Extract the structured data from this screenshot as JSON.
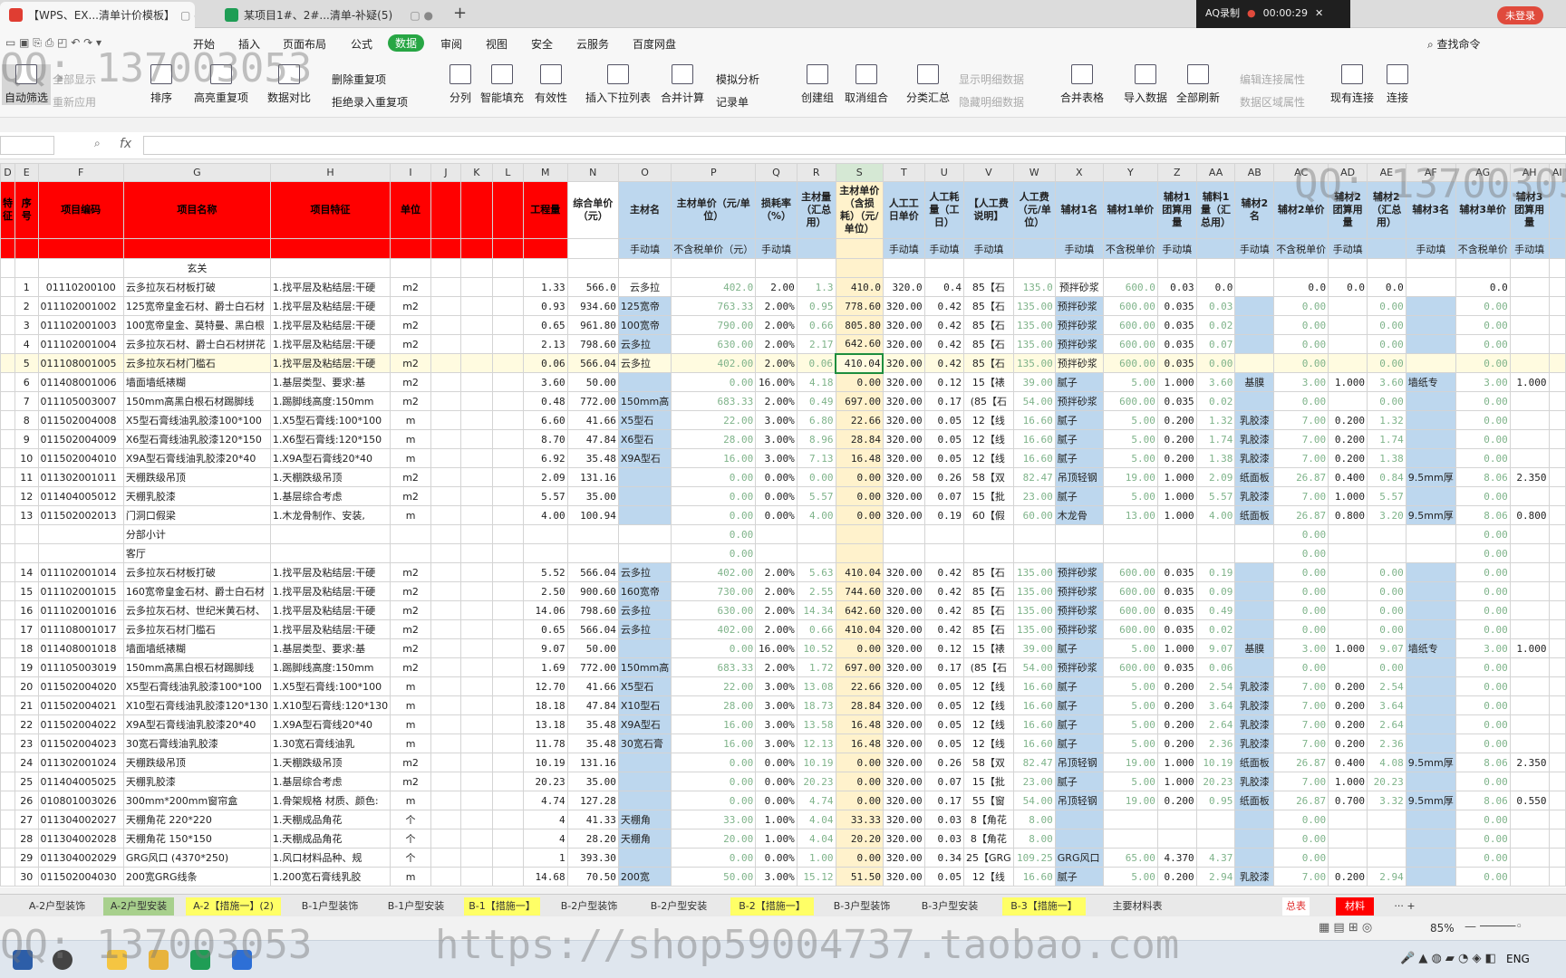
{
  "tabs": [
    {
      "label": "【WPS、EX...清单计价模板】",
      "active": true
    },
    {
      "label": "某项目1#、2#...清单-补疑(5)",
      "active": false
    }
  ],
  "recorder": {
    "name": "AQ录制",
    "time": "00:00:29"
  },
  "login_label": "未登录",
  "menu": [
    "开始",
    "插入",
    "页面布局",
    "公式",
    "数据",
    "审阅",
    "视图",
    "安全",
    "云服务",
    "百度网盘"
  ],
  "find_label": "查找命令",
  "ribbon": {
    "filter": "自动筛选",
    "show_all": "全部显示",
    "reapply": "重新应用",
    "sort": "排序",
    "highlight_dup": "高亮重复项",
    "data_compare": "数据对比",
    "delete_dup": "删除重复项",
    "reject_dup": "拒绝录入重复项",
    "split": "分列",
    "smart_fill": "智能填充",
    "validity": "有效性",
    "dropdown_list": "插入下拉列表",
    "merge_calc": "合并计算",
    "simulate": "模拟分析",
    "record": "记录单",
    "create_group": "创建组",
    "ungroup": "取消组合",
    "subtotal": "分类汇总",
    "show_detail": "显示明细数据",
    "hide_detail": "隐藏明细数据",
    "merge_sheets": "合并表格",
    "import_data": "导入数据",
    "refresh_all": "全部刷新",
    "edit_link": "编辑连接属性",
    "data_range": "数据区域属性",
    "existing_conn": "现有连接",
    "connect": "连接"
  },
  "formula_bar": {
    "fx": "fx"
  },
  "columns": [
    "D",
    "E",
    "F",
    "G",
    "H",
    "I",
    "J",
    "K",
    "L",
    "M",
    "N",
    "O",
    "P",
    "Q",
    "R",
    "S",
    "T",
    "U",
    "V",
    "W",
    "X",
    "Y",
    "Z",
    "AA",
    "AB",
    "AC",
    "AD",
    "AE",
    "AF",
    "AG",
    "AH",
    "AI"
  ],
  "headers": [
    "特征",
    "序号",
    "项目编码",
    "项目名称",
    "项目特征",
    "单位",
    "",
    "",
    "",
    "工程量",
    "综合单价（元）",
    "主材名",
    "主材单价（元/单位）",
    "损耗率（%）",
    "主材量（汇总用）",
    "主材单价（含损耗）（元/单位）",
    "人工工日单价",
    "人工耗量（工日）",
    "【人工费说明】",
    "人工费（元/单位）",
    "辅材1名",
    "辅材1单价",
    "辅材1团算用量",
    "辅料1量（汇总用）",
    "辅材2名",
    "辅材2单价",
    "辅材2团算用量",
    "辅材2（汇总用）",
    "辅材3名",
    "辅材3单价",
    "辅材3团算用量",
    ""
  ],
  "subheaders": [
    "",
    "",
    "",
    "",
    "",
    "",
    "",
    "",
    "",
    "",
    "",
    "手动填",
    "不含税单价（元）",
    "手动填",
    "",
    "",
    "手动填",
    "手动填",
    "手动填",
    "",
    "手动填",
    "不含税单价",
    "手动填",
    "",
    "手动填",
    "不含税单价",
    "手动填",
    "",
    "手动填",
    "不含税单价",
    "手动填",
    ""
  ],
  "section_row": {
    "g": "玄关"
  },
  "filter_row": {
    "e": "1",
    "f": "01110200100",
    "g": "云多拉灰石材板打破",
    "h": "1.找平层及粘结层:干硬",
    "i": "m2",
    "m": "1.33",
    "n": "566.0",
    "o": "云多拉",
    "p": "402.0",
    "q": "2.00",
    "r": "1.3",
    "s": "410.0",
    "t": "320.0",
    "u": "0.4",
    "v": "85【石",
    "w": "135.0",
    "x": "预拌砂浆",
    "y": "600.0",
    "z": "0.03",
    "aa": "0.0",
    "ac": "0.0",
    "ad": "0.0",
    "ae": "0.0",
    "ag": "0.0"
  },
  "rows": [
    {
      "e": "2",
      "f": "011102001002",
      "g": "125宽帝皇金石材、爵士白石材",
      "h": "1.找平层及粘结层:干硬",
      "i": "m2",
      "m": "0.93",
      "n": "934.60",
      "o": "125宽帝",
      "p": "763.33",
      "q": "2.00%",
      "r": "0.95",
      "s": "778.60",
      "t": "320.00",
      "u": "0.42",
      "v": "85【石",
      "w": "135.00",
      "x": "预拌砂浆",
      "y": "600.00",
      "z": "0.035",
      "aa": "0.03",
      "ac": "0.00",
      "ae": "0.00",
      "ag": "0.00"
    },
    {
      "e": "3",
      "f": "011102001003",
      "g": "100宽帝皇金、莫特曼、黑白根",
      "h": "1.找平层及粘结层:干硬",
      "i": "m2",
      "m": "0.65",
      "n": "961.80",
      "o": "100宽帝",
      "p": "790.00",
      "q": "2.00%",
      "r": "0.66",
      "s": "805.80",
      "t": "320.00",
      "u": "0.42",
      "v": "85【石",
      "w": "135.00",
      "x": "预拌砂浆",
      "y": "600.00",
      "z": "0.035",
      "aa": "0.02",
      "ac": "0.00",
      "ae": "0.00",
      "ag": "0.00"
    },
    {
      "e": "4",
      "f": "011102001004",
      "g": "云多拉灰石材、爵士白石材拼花",
      "h": "1.找平层及粘结层:干硬",
      "i": "m2",
      "m": "2.13",
      "n": "798.60",
      "o": "云多拉",
      "p": "630.00",
      "q": "2.00%",
      "r": "2.17",
      "s": "642.60",
      "t": "320.00",
      "u": "0.42",
      "v": "85【石",
      "w": "135.00",
      "x": "预拌砂浆",
      "y": "600.00",
      "z": "0.035",
      "aa": "0.07",
      "ac": "0.00",
      "ae": "0.00",
      "ag": "0.00"
    },
    {
      "hl": true,
      "e": "5",
      "f": "011108001005",
      "g": "云多拉灰石材门槛石",
      "h": "1.找平层及粘结层:干硬",
      "i": "m2",
      "m": "0.06",
      "n": "566.04",
      "o": "云多拉",
      "p": "402.00",
      "q": "2.00%",
      "r": "0.06",
      "s": "410.04",
      "t": "320.00",
      "u": "0.42",
      "v": "85【石",
      "w": "135.00",
      "x": "预拌砂浆",
      "y": "600.00",
      "z": "0.035",
      "aa": "0.00",
      "ac": "0.00",
      "ae": "0.00",
      "ag": "0.00"
    },
    {
      "e": "6",
      "f": "011408001006",
      "g": "墙面墙纸裱糊",
      "h": "1.基层类型、要求:基",
      "i": "m2",
      "m": "3.60",
      "n": "50.00",
      "o": "",
      "p": "0.00",
      "q": "16.00%",
      "r": "4.18",
      "s": "0.00",
      "t": "320.00",
      "u": "0.12",
      "v": "15【裱",
      "w": "39.00",
      "x": "腻子",
      "y": "5.00",
      "z": "1.000",
      "aa": "3.60",
      "ab": "基膜",
      "ac": "3.00",
      "ad": "1.000",
      "ae": "3.60",
      "af": "墙纸专",
      "ag": "3.00",
      "ah": "1.000"
    },
    {
      "e": "7",
      "f": "011105003007",
      "g": "150mm高黑白根石材踢脚线",
      "h": "1.踢脚线高度:150mm",
      "i": "m2",
      "m": "0.48",
      "n": "772.00",
      "o": "150mm高",
      "p": "683.33",
      "q": "2.00%",
      "r": "0.49",
      "s": "697.00",
      "t": "320.00",
      "u": "0.17",
      "v": "(85【石",
      "w": "54.00",
      "x": "预拌砂浆",
      "y": "600.00",
      "z": "0.035",
      "aa": "0.02",
      "ac": "0.00",
      "ae": "0.00",
      "ag": "0.00"
    },
    {
      "e": "8",
      "f": "011502004008",
      "g": "X5型石膏线油乳胶漆100*100",
      "h": "1.X5型石膏线:100*100",
      "i": "m",
      "m": "6.60",
      "n": "41.66",
      "o": "X5型石",
      "p": "22.00",
      "q": "3.00%",
      "r": "6.80",
      "s": "22.66",
      "t": "320.00",
      "u": "0.05",
      "v": "12【线",
      "w": "16.60",
      "x": "腻子",
      "y": "5.00",
      "z": "0.200",
      "aa": "1.32",
      "ab": "乳胶漆",
      "ac": "7.00",
      "ad": "0.200",
      "ae": "1.32",
      "ag": "0.00"
    },
    {
      "e": "9",
      "f": "011502004009",
      "g": "X6型石膏线油乳胶漆120*150",
      "h": "1.X6型石膏线:120*150",
      "i": "m",
      "m": "8.70",
      "n": "47.84",
      "o": "X6型石",
      "p": "28.00",
      "q": "3.00%",
      "r": "8.96",
      "s": "28.84",
      "t": "320.00",
      "u": "0.05",
      "v": "12【线",
      "w": "16.60",
      "x": "腻子",
      "y": "5.00",
      "z": "0.200",
      "aa": "1.74",
      "ab": "乳胶漆",
      "ac": "7.00",
      "ad": "0.200",
      "ae": "1.74",
      "ag": "0.00"
    },
    {
      "e": "10",
      "f": "011502004010",
      "g": "X9A型石膏线油乳胶漆20*40",
      "h": "1.X9A型石膏线20*40",
      "i": "m",
      "m": "6.92",
      "n": "35.48",
      "o": "X9A型石",
      "p": "16.00",
      "q": "3.00%",
      "r": "7.13",
      "s": "16.48",
      "t": "320.00",
      "u": "0.05",
      "v": "12【线",
      "w": "16.60",
      "x": "腻子",
      "y": "5.00",
      "z": "0.200",
      "aa": "1.38",
      "ab": "乳胶漆",
      "ac": "7.00",
      "ad": "0.200",
      "ae": "1.38",
      "ag": "0.00"
    },
    {
      "e": "11",
      "f": "011302001011",
      "g": "天棚跌级吊顶",
      "h": "1.天棚跌级吊顶",
      "i": "m2",
      "m": "2.09",
      "n": "131.16",
      "o": "",
      "p": "0.00",
      "q": "0.00%",
      "r": "0.00",
      "s": "0.00",
      "t": "320.00",
      "u": "0.26",
      "v": "58【双",
      "w": "82.47",
      "x": "吊顶轻钢",
      "y": "19.00",
      "z": "1.000",
      "aa": "2.09",
      "ab": "纸面板",
      "ac": "26.87",
      "ad": "0.400",
      "ae": "0.84",
      "af": "9.5mm厚",
      "ag": "8.06",
      "ah": "2.350"
    },
    {
      "e": "12",
      "f": "011404005012",
      "g": "天棚乳胶漆",
      "h": "1.基层综合考虑",
      "i": "m2",
      "m": "5.57",
      "n": "35.00",
      "o": "",
      "p": "0.00",
      "q": "0.00%",
      "r": "5.57",
      "s": "0.00",
      "t": "320.00",
      "u": "0.07",
      "v": "15【批",
      "w": "23.00",
      "x": "腻子",
      "y": "5.00",
      "z": "1.000",
      "aa": "5.57",
      "ab": "乳胶漆",
      "ac": "7.00",
      "ad": "1.000",
      "ae": "5.57",
      "ag": "0.00"
    },
    {
      "e": "13",
      "f": "011502002013",
      "g": "门洞口假梁",
      "h": "1.木龙骨制作、安装,",
      "i": "m",
      "m": "4.00",
      "n": "100.94",
      "o": "",
      "p": "0.00",
      "q": "0.00%",
      "r": "4.00",
      "s": "0.00",
      "t": "320.00",
      "u": "0.19",
      "v": "60【假",
      "w": "60.00",
      "x": "木龙骨",
      "y": "13.00",
      "z": "1.000",
      "aa": "4.00",
      "ab": "纸面板",
      "ac": "26.87",
      "ad": "0.800",
      "ae": "3.20",
      "af": "9.5mm厚",
      "ag": "8.06",
      "ah": "0.800"
    },
    {
      "kind": "subtotal",
      "g": "分部小计",
      "p": "0.00",
      "ac": "0.00",
      "ag": "0.00"
    },
    {
      "kind": "section",
      "g": "客厅",
      "p": "0.00",
      "ac": "0.00",
      "ag": "0.00"
    },
    {
      "e": "14",
      "f": "011102001014",
      "g": "云多拉灰石材板打破",
      "h": "1.找平层及粘结层:干硬",
      "i": "m2",
      "m": "5.52",
      "n": "566.04",
      "o": "云多拉",
      "p": "402.00",
      "q": "2.00%",
      "r": "5.63",
      "s": "410.04",
      "t": "320.00",
      "u": "0.42",
      "v": "85【石",
      "w": "135.00",
      "x": "预拌砂浆",
      "y": "600.00",
      "z": "0.035",
      "aa": "0.19",
      "ac": "0.00",
      "ae": "0.00",
      "ag": "0.00"
    },
    {
      "e": "15",
      "f": "011102001015",
      "g": "160宽帝皇金石材、爵士白石材",
      "h": "1.找平层及粘结层:干硬",
      "i": "m2",
      "m": "2.50",
      "n": "900.60",
      "o": "160宽帝",
      "p": "730.00",
      "q": "2.00%",
      "r": "2.55",
      "s": "744.60",
      "t": "320.00",
      "u": "0.42",
      "v": "85【石",
      "w": "135.00",
      "x": "预拌砂浆",
      "y": "600.00",
      "z": "0.035",
      "aa": "0.09",
      "ac": "0.00",
      "ae": "0.00",
      "ag": "0.00"
    },
    {
      "e": "16",
      "f": "011102001016",
      "g": "云多拉灰石材、世纪米黄石材、",
      "h": "1.找平层及粘结层:干硬",
      "i": "m2",
      "m": "14.06",
      "n": "798.60",
      "o": "云多拉",
      "p": "630.00",
      "q": "2.00%",
      "r": "14.34",
      "s": "642.60",
      "t": "320.00",
      "u": "0.42",
      "v": "85【石",
      "w": "135.00",
      "x": "预拌砂浆",
      "y": "600.00",
      "z": "0.035",
      "aa": "0.49",
      "ac": "0.00",
      "ae": "0.00",
      "ag": "0.00"
    },
    {
      "e": "17",
      "f": "011108001017",
      "g": "云多拉灰石材门槛石",
      "h": "1.找平层及粘结层:干硬",
      "i": "m2",
      "m": "0.65",
      "n": "566.04",
      "o": "云多拉",
      "p": "402.00",
      "q": "2.00%",
      "r": "0.66",
      "s": "410.04",
      "t": "320.00",
      "u": "0.42",
      "v": "85【石",
      "w": "135.00",
      "x": "预拌砂浆",
      "y": "600.00",
      "z": "0.035",
      "aa": "0.02",
      "ac": "0.00",
      "ae": "0.00",
      "ag": "0.00"
    },
    {
      "e": "18",
      "f": "011408001018",
      "g": "墙面墙纸裱糊",
      "h": "1.基层类型、要求:基",
      "i": "m2",
      "m": "9.07",
      "n": "50.00",
      "o": "",
      "p": "0.00",
      "q": "16.00%",
      "r": "10.52",
      "s": "0.00",
      "t": "320.00",
      "u": "0.12",
      "v": "15【裱",
      "w": "39.00",
      "x": "腻子",
      "y": "5.00",
      "z": "1.000",
      "aa": "9.07",
      "ab": "基膜",
      "ac": "3.00",
      "ad": "1.000",
      "ae": "9.07",
      "af": "墙纸专",
      "ag": "3.00",
      "ah": "1.000"
    },
    {
      "e": "19",
      "f": "011105003019",
      "g": "150mm高黑白根石材踢脚线",
      "h": "1.踢脚线高度:150mm",
      "i": "m2",
      "m": "1.69",
      "n": "772.00",
      "o": "150mm高",
      "p": "683.33",
      "q": "2.00%",
      "r": "1.72",
      "s": "697.00",
      "t": "320.00",
      "u": "0.17",
      "v": "(85【石",
      "w": "54.00",
      "x": "预拌砂浆",
      "y": "600.00",
      "z": "0.035",
      "aa": "0.06",
      "ac": "0.00",
      "ae": "0.00",
      "ag": "0.00"
    },
    {
      "e": "20",
      "f": "011502004020",
      "g": "X5型石膏线油乳胶漆100*100",
      "h": "1.X5型石膏线:100*100",
      "i": "m",
      "m": "12.70",
      "n": "41.66",
      "o": "X5型石",
      "p": "22.00",
      "q": "3.00%",
      "r": "13.08",
      "s": "22.66",
      "t": "320.00",
      "u": "0.05",
      "v": "12【线",
      "w": "16.60",
      "x": "腻子",
      "y": "5.00",
      "z": "0.200",
      "aa": "2.54",
      "ab": "乳胶漆",
      "ac": "7.00",
      "ad": "0.200",
      "ae": "2.54",
      "ag": "0.00"
    },
    {
      "e": "21",
      "f": "011502004021",
      "g": "X10型石膏线油乳胶漆120*130",
      "h": "1.X10型石膏线:120*130",
      "i": "m",
      "m": "18.18",
      "n": "47.84",
      "o": "X10型石",
      "p": "28.00",
      "q": "3.00%",
      "r": "18.73",
      "s": "28.84",
      "t": "320.00",
      "u": "0.05",
      "v": "12【线",
      "w": "16.60",
      "x": "腻子",
      "y": "5.00",
      "z": "0.200",
      "aa": "3.64",
      "ab": "乳胶漆",
      "ac": "7.00",
      "ad": "0.200",
      "ae": "3.64",
      "ag": "0.00"
    },
    {
      "e": "22",
      "f": "011502004022",
      "g": "X9A型石膏线油乳胶漆20*40",
      "h": "1.X9A型石膏线20*40",
      "i": "m",
      "m": "13.18",
      "n": "35.48",
      "o": "X9A型石",
      "p": "16.00",
      "q": "3.00%",
      "r": "13.58",
      "s": "16.48",
      "t": "320.00",
      "u": "0.05",
      "v": "12【线",
      "w": "16.60",
      "x": "腻子",
      "y": "5.00",
      "z": "0.200",
      "aa": "2.64",
      "ab": "乳胶漆",
      "ac": "7.00",
      "ad": "0.200",
      "ae": "2.64",
      "ag": "0.00"
    },
    {
      "e": "23",
      "f": "011502004023",
      "g": "30宽石膏线油乳胶漆",
      "h": "1.30宽石膏线油乳",
      "i": "m",
      "m": "11.78",
      "n": "35.48",
      "o": "30宽石膏",
      "p": "16.00",
      "q": "3.00%",
      "r": "12.13",
      "s": "16.48",
      "t": "320.00",
      "u": "0.05",
      "v": "12【线",
      "w": "16.60",
      "x": "腻子",
      "y": "5.00",
      "z": "0.200",
      "aa": "2.36",
      "ab": "乳胶漆",
      "ac": "7.00",
      "ad": "0.200",
      "ae": "2.36",
      "ag": "0.00"
    },
    {
      "e": "24",
      "f": "011302001024",
      "g": "天棚跌级吊顶",
      "h": "1.天棚跌级吊顶",
      "i": "m2",
      "m": "10.19",
      "n": "131.16",
      "o": "",
      "p": "0.00",
      "q": "0.00%",
      "r": "10.19",
      "s": "0.00",
      "t": "320.00",
      "u": "0.26",
      "v": "58【双",
      "w": "82.47",
      "x": "吊顶轻钢",
      "y": "19.00",
      "z": "1.000",
      "aa": "10.19",
      "ab": "纸面板",
      "ac": "26.87",
      "ad": "0.400",
      "ae": "4.08",
      "af": "9.5mm厚",
      "ag": "8.06",
      "ah": "2.350"
    },
    {
      "e": "25",
      "f": "011404005025",
      "g": "天棚乳胶漆",
      "h": "1.基层综合考虑",
      "i": "m2",
      "m": "20.23",
      "n": "35.00",
      "o": "",
      "p": "0.00",
      "q": "0.00%",
      "r": "20.23",
      "s": "0.00",
      "t": "320.00",
      "u": "0.07",
      "v": "15【批",
      "w": "23.00",
      "x": "腻子",
      "y": "5.00",
      "z": "1.000",
      "aa": "20.23",
      "ab": "乳胶漆",
      "ac": "7.00",
      "ad": "1.000",
      "ae": "20.23",
      "ag": "0.00"
    },
    {
      "e": "26",
      "f": "010801003026",
      "g": "300mm*200mm窗帘盒",
      "h": "1.骨架规格 材质、颜色:",
      "i": "m",
      "m": "4.74",
      "n": "127.28",
      "o": "",
      "p": "0.00",
      "q": "0.00%",
      "r": "4.74",
      "s": "0.00",
      "t": "320.00",
      "u": "0.17",
      "v": "55【窗",
      "w": "54.00",
      "x": "吊顶轻钢",
      "y": "19.00",
      "z": "0.200",
      "aa": "0.95",
      "ab": "纸面板",
      "ac": "26.87",
      "ad": "0.700",
      "ae": "3.32",
      "af": "9.5mm厚",
      "ag": "8.06",
      "ah": "0.550"
    },
    {
      "e": "27",
      "f": "011304002027",
      "g": "天棚角花 220*220",
      "h": "1.天棚成品角花",
      "i": "个",
      "m": "4",
      "n": "41.33",
      "o": "天棚角",
      "p": "33.00",
      "q": "1.00%",
      "r": "4.04",
      "s": "33.33",
      "t": "320.00",
      "u": "0.03",
      "v": "8【角花",
      "w": "8.00",
      "ac": "0.00",
      "ag": "0.00"
    },
    {
      "e": "28",
      "f": "011304002028",
      "g": "天棚角花 150*150",
      "h": "1.天棚成品角花",
      "i": "个",
      "m": "4",
      "n": "28.20",
      "o": "天棚角",
      "p": "20.00",
      "q": "1.00%",
      "r": "4.04",
      "s": "20.20",
      "t": "320.00",
      "u": "0.03",
      "v": "8【角花",
      "w": "8.00",
      "ac": "0.00",
      "ag": "0.00"
    },
    {
      "e": "29",
      "f": "011304002029",
      "g": "GRG风口 (4370*250)",
      "h": "1.风口材料品种、规",
      "i": "个",
      "m": "1",
      "n": "393.30",
      "o": "",
      "p": "0.00",
      "q": "0.00%",
      "r": "1.00",
      "s": "0.00",
      "t": "320.00",
      "u": "0.34",
      "v": "25【GRG",
      "w": "109.25",
      "x": "GRG风口",
      "y": "65.00",
      "z": "4.370",
      "aa": "4.37",
      "ac": "0.00",
      "ag": "0.00"
    },
    {
      "e": "30",
      "f": "011502004030",
      "g": "200宽GRG线条",
      "h": "1.200宽石膏线乳胶",
      "i": "m",
      "m": "14.68",
      "n": "70.50",
      "o": "200宽",
      "p": "50.00",
      "q": "3.00%",
      "r": "15.12",
      "s": "51.50",
      "t": "320.00",
      "u": "0.05",
      "v": "12【线",
      "w": "16.60",
      "x": "腻子",
      "y": "5.00",
      "z": "0.200",
      "aa": "2.94",
      "ab": "乳胶漆",
      "ac": "7.00",
      "ad": "0.200",
      "ae": "2.94",
      "ag": "0.00"
    }
  ],
  "sheet_tabs": [
    {
      "label": "A-2户型装饰",
      "style": "plain"
    },
    {
      "label": "A-2户型安装",
      "style": "green"
    },
    {
      "label": "A-2【措施一】(2)",
      "style": "yellow"
    },
    {
      "label": "B-1户型装饰",
      "style": "plain"
    },
    {
      "label": "B-1户型安装",
      "style": "plain"
    },
    {
      "label": "B-1【措施一】",
      "style": "yellow"
    },
    {
      "label": "B-2户型装饰",
      "style": "plain"
    },
    {
      "label": "B-2户型安装",
      "style": "plain"
    },
    {
      "label": "B-2【措施一】",
      "style": "yellow"
    },
    {
      "label": "B-3户型装饰",
      "style": "plain"
    },
    {
      "label": "B-3户型安装",
      "style": "plain"
    },
    {
      "label": "B-3【措施一】",
      "style": "yellow"
    },
    {
      "label": "主要材料表",
      "style": "plain"
    },
    {
      "label": "总表",
      "style": "white"
    },
    {
      "label": "材料",
      "style": "red"
    }
  ],
  "zoom": "85%",
  "lang": "ENG",
  "watermarks": {
    "qq": "QQ: 137003053",
    "url": "https://shop59004737.taobao.com"
  }
}
